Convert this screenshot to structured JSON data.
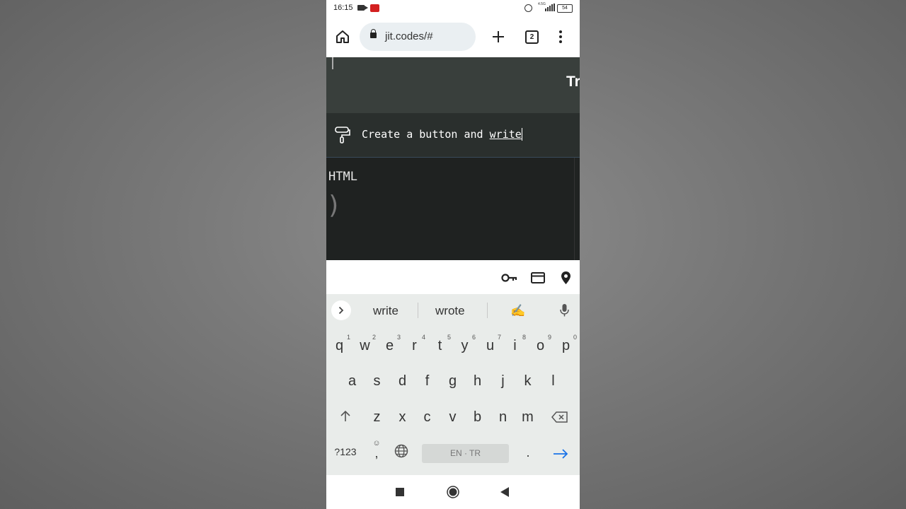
{
  "status_bar": {
    "time": "16:15",
    "network": "4.5G",
    "battery": "54"
  },
  "browser": {
    "url": "jit.codes/#",
    "tab_count": "2"
  },
  "page": {
    "header_title": "Tr",
    "prompt_text_before": "Create a button and ",
    "prompt_text_current": "write",
    "code_language": "HTML",
    "code_fragment": ")"
  },
  "keyboard": {
    "suggestions": [
      "write",
      "wrote"
    ],
    "suggestion_emoji": "✍️",
    "row1": [
      {
        "key": "q",
        "num": "1"
      },
      {
        "key": "w",
        "num": "2"
      },
      {
        "key": "e",
        "num": "3"
      },
      {
        "key": "r",
        "num": "4"
      },
      {
        "key": "t",
        "num": "5"
      },
      {
        "key": "y",
        "num": "6"
      },
      {
        "key": "u",
        "num": "7"
      },
      {
        "key": "i",
        "num": "8"
      },
      {
        "key": "o",
        "num": "9"
      },
      {
        "key": "p",
        "num": "0"
      }
    ],
    "row2": [
      "a",
      "s",
      "d",
      "f",
      "g",
      "h",
      "j",
      "k",
      "l"
    ],
    "row3": [
      "z",
      "x",
      "c",
      "v",
      "b",
      "n",
      "m"
    ],
    "symbols_label": "?123",
    "comma": ",",
    "space_label": "EN · TR",
    "period": "."
  }
}
